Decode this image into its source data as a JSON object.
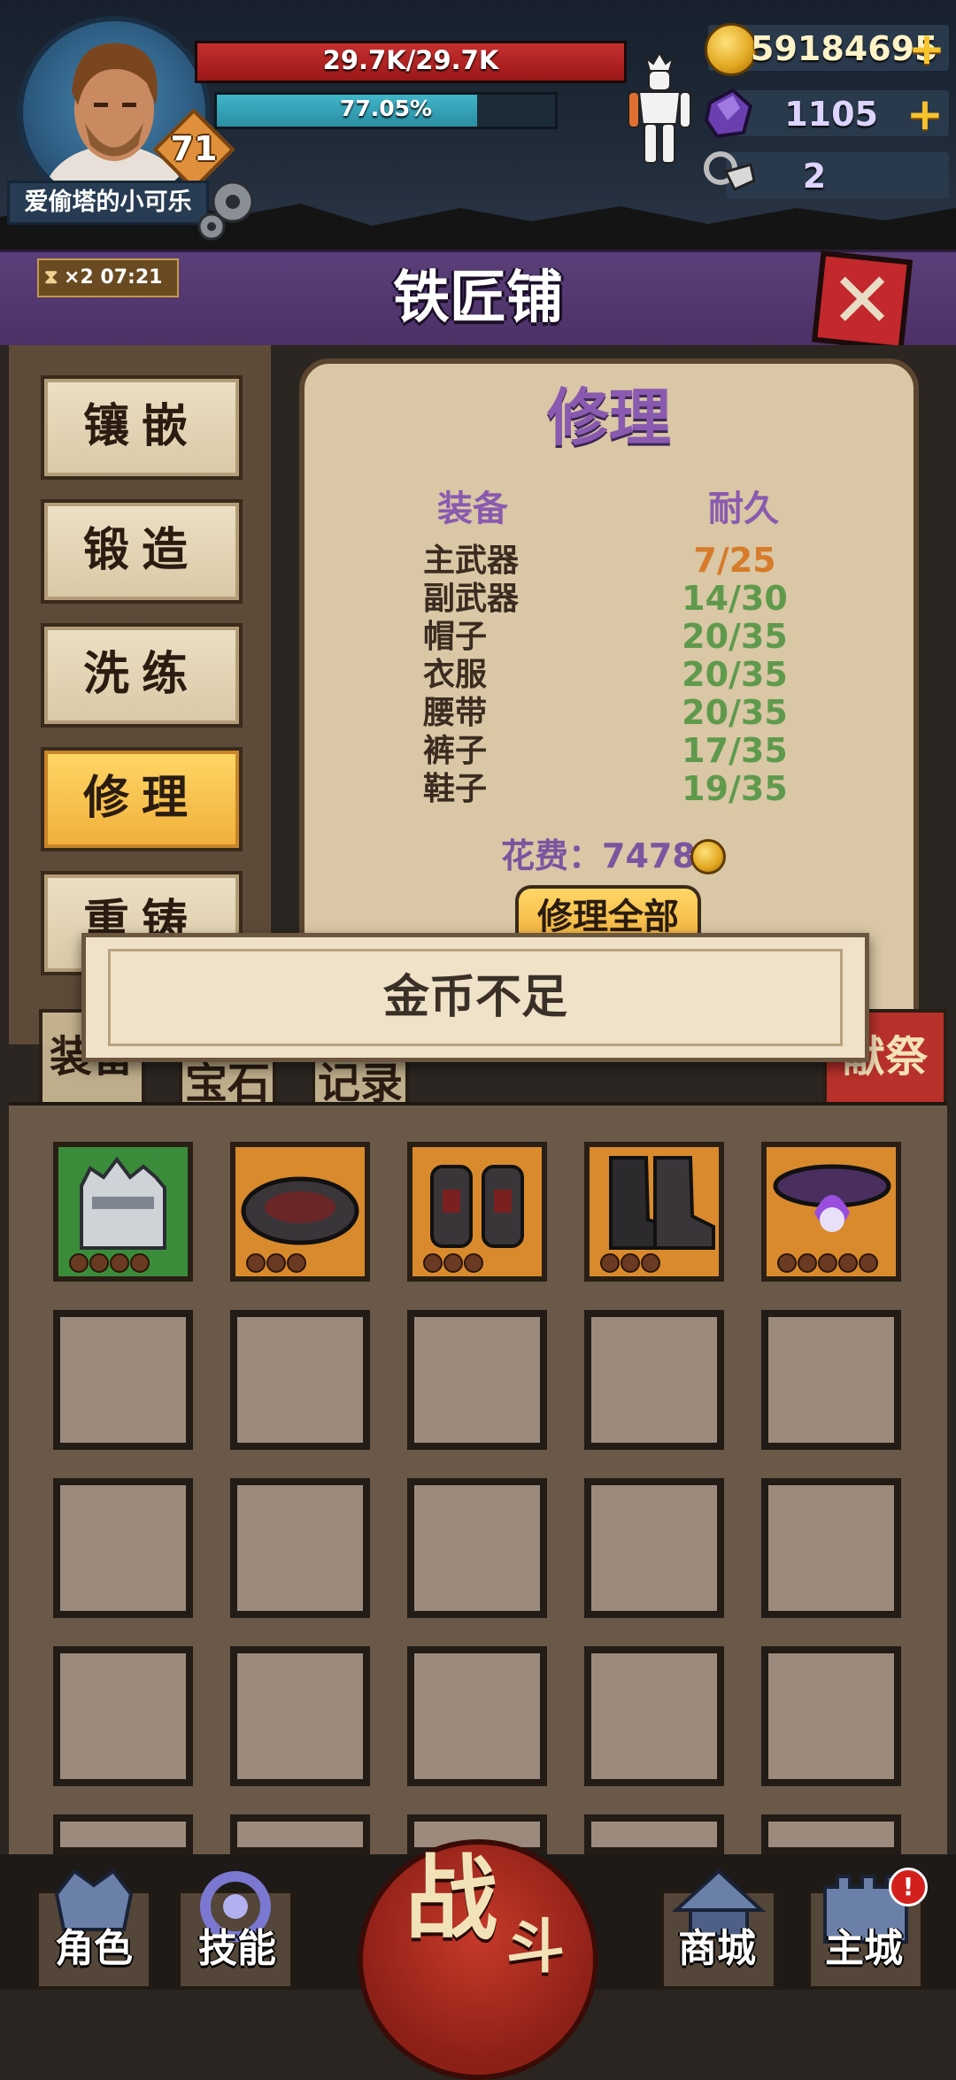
{
  "hud": {
    "hp_text": "29.7K/29.7K",
    "hp_fraction": 1.0,
    "xp_text": "77.05%",
    "xp_fraction": 0.7705,
    "level": "71",
    "player_name": "爱偷塔的小可乐",
    "gold": "59184695",
    "gems": "1105",
    "keys": "2",
    "plus_symbol": "+"
  },
  "shop": {
    "title": "铁匠铺",
    "timer_multiplier": "×2",
    "timer_time": "07:21",
    "close_symbol": "✕"
  },
  "menu": {
    "items": [
      {
        "label": "镶嵌",
        "active": false
      },
      {
        "label": "锻造",
        "active": false
      },
      {
        "label": "洗练",
        "active": false
      },
      {
        "label": "修理",
        "active": true
      },
      {
        "label": "重铸",
        "active": false
      }
    ]
  },
  "repair": {
    "title": "修理",
    "col_equipment": "装备",
    "col_durability": "耐久",
    "rows": [
      {
        "name": "主武器",
        "durability": "7/25",
        "status": "low"
      },
      {
        "name": "副武器",
        "durability": "14/30",
        "status": "ok"
      },
      {
        "name": "帽子",
        "durability": "20/35",
        "status": "ok"
      },
      {
        "name": "衣服",
        "durability": "20/35",
        "status": "ok"
      },
      {
        "name": "腰带",
        "durability": "20/35",
        "status": "ok"
      },
      {
        "name": "裤子",
        "durability": "17/35",
        "status": "ok"
      },
      {
        "name": "鞋子",
        "durability": "19/35",
        "status": "ok"
      }
    ],
    "cost_label": "花费：",
    "cost_value": "7478",
    "repair_all_label": "修理全部"
  },
  "tabs": {
    "items": [
      "装备",
      "宝石",
      "记录",
      "献祭"
    ]
  },
  "toast": {
    "message": "金币不足"
  },
  "inventory": {
    "items": [
      {
        "icon": "helmet-icon",
        "rarity_color": "#3b8c3a"
      },
      {
        "icon": "belt-icon",
        "rarity_color": "#d98a2d"
      },
      {
        "icon": "gauntlets-icon",
        "rarity_color": "#d98a2d"
      },
      {
        "icon": "boots-icon",
        "rarity_color": "#d98a2d"
      },
      {
        "icon": "cursed-belt-icon",
        "rarity_color": "#d98a2d"
      }
    ]
  },
  "nav": {
    "character": "角色",
    "skills": "技能",
    "battle_1": "战",
    "battle_2": "斗",
    "shop": "商城",
    "city": "主城",
    "city_badge": "!"
  }
}
